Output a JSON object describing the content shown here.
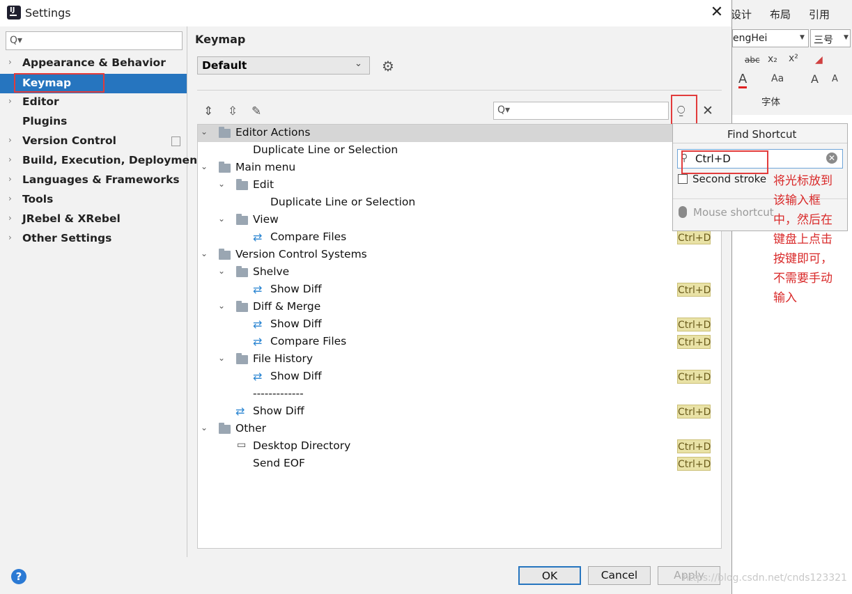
{
  "window": {
    "title": "Settings",
    "close": "✕"
  },
  "sidebar": {
    "search_icon": "Q▾",
    "items": [
      {
        "label": "Appearance & Behavior",
        "chevron": "›"
      },
      {
        "label": "Keymap",
        "chevron": ""
      },
      {
        "label": "Editor",
        "chevron": "›"
      },
      {
        "label": "Plugins",
        "chevron": ""
      },
      {
        "label": "Version Control",
        "chevron": "›"
      },
      {
        "label": "Build, Execution, Deployment",
        "chevron": "›"
      },
      {
        "label": "Languages & Frameworks",
        "chevron": "›"
      },
      {
        "label": "Tools",
        "chevron": "›"
      },
      {
        "label": "JRebel & XRebel",
        "chevron": "›"
      },
      {
        "label": "Other Settings",
        "chevron": "›"
      }
    ],
    "selected": "Keymap"
  },
  "main": {
    "heading": "Keymap",
    "keymap_select": "Default",
    "filter_icon": "Q▾",
    "tree": [
      {
        "label": "Editor Actions",
        "toggle": "⌄",
        "shortcut": ""
      },
      {
        "label": "Duplicate Line or Selection",
        "toggle": "",
        "shortcut": ""
      },
      {
        "label": "Main menu",
        "toggle": "⌄",
        "shortcut": ""
      },
      {
        "label": "Edit",
        "toggle": "⌄",
        "shortcut": ""
      },
      {
        "label": "Duplicate Line or Selection",
        "toggle": "",
        "shortcut": ""
      },
      {
        "label": "View",
        "toggle": "⌄",
        "shortcut": ""
      },
      {
        "label": "Compare Files",
        "toggle": "",
        "shortcut": "Ctrl+D"
      },
      {
        "label": "Version Control Systems",
        "toggle": "⌄",
        "shortcut": ""
      },
      {
        "label": "Shelve",
        "toggle": "⌄",
        "shortcut": ""
      },
      {
        "label": "Show Diff",
        "toggle": "",
        "shortcut": "Ctrl+D"
      },
      {
        "label": "Diff & Merge",
        "toggle": "⌄",
        "shortcut": ""
      },
      {
        "label": "Show Diff",
        "toggle": "",
        "shortcut": "Ctrl+D"
      },
      {
        "label": "Compare Files",
        "toggle": "",
        "shortcut": "Ctrl+D"
      },
      {
        "label": "File History",
        "toggle": "⌄",
        "shortcut": ""
      },
      {
        "label": "Show Diff",
        "toggle": "",
        "shortcut": "Ctrl+D"
      },
      {
        "label": "-------------",
        "toggle": "",
        "shortcut": ""
      },
      {
        "label": "Show Diff",
        "toggle": "",
        "shortcut": "Ctrl+D"
      },
      {
        "label": "Other",
        "toggle": "⌄",
        "shortcut": ""
      },
      {
        "label": "Desktop Directory",
        "toggle": "",
        "shortcut": "Ctrl+D"
      },
      {
        "label": "Send EOF",
        "toggle": "",
        "shortcut": "Ctrl+D"
      }
    ]
  },
  "popup": {
    "title": "Find Shortcut",
    "field_value": "Ctrl+D",
    "second_stroke": "Second stroke",
    "mouse_shortcut": "Mouse shortcut"
  },
  "annotation": [
    "将光标放到",
    "该输入框",
    "中，然后在",
    "键盘上点击",
    "按键即可，",
    "不需要手动",
    "输入"
  ],
  "footer": {
    "help": "?",
    "ok": "OK",
    "cancel": "Cancel",
    "apply": "Apply"
  },
  "word": {
    "tabs": [
      "设计",
      "布局",
      "引用"
    ],
    "font": "engHei",
    "size": "三号",
    "group": "字体",
    "icons": [
      "abc",
      "x₂",
      "x²",
      "A",
      "Aa",
      "A",
      "A"
    ]
  },
  "watermark": "https://blog.csdn.net/cnds123321",
  "colors": {
    "selection": "#2675bf",
    "annotation": "#d92a2a",
    "shortcut_badge": "#e9e2a6"
  }
}
